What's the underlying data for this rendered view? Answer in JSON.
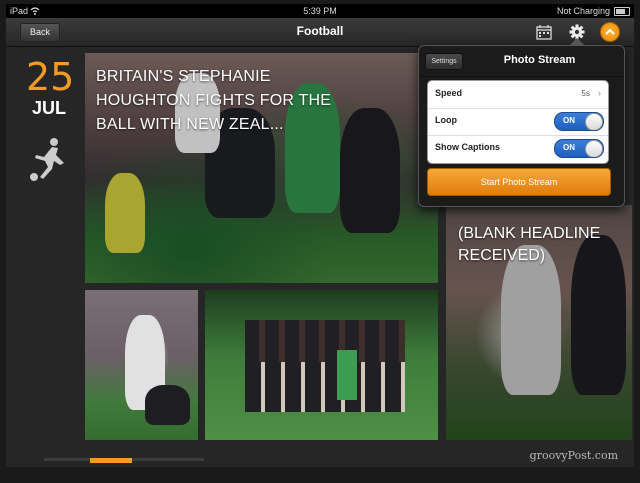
{
  "status_bar": {
    "device": "iPad",
    "time": "5:39 PM",
    "charging": "Not Charging"
  },
  "nav": {
    "back_label": "Back",
    "title": "Football",
    "icons": [
      "calendar-icon",
      "gear-icon",
      "chevron-up-icon"
    ]
  },
  "date": {
    "day": "25",
    "month": "JUL",
    "sport_icon": "football-player-icon"
  },
  "stories": [
    {
      "headline": "BRITAIN'S STEPHANIE HOUGHTON FIGHTS FOR THE BALL WITH NEW ZEAL..."
    },
    {
      "headline": "(BLANK HEADLINE RECEIVED)"
    }
  ],
  "popover": {
    "settings_label": "Settings",
    "title": "Photo Stream",
    "rows": [
      {
        "label": "Speed",
        "value": "5s"
      },
      {
        "label": "Loop",
        "value": "ON"
      },
      {
        "label": "Show Captions",
        "value": "ON"
      }
    ],
    "start_label": "Start Photo Stream"
  },
  "watermark": "groovyPost.com",
  "colors": {
    "accent": "#f39b25",
    "toggle_on": "#2f6fd0"
  }
}
